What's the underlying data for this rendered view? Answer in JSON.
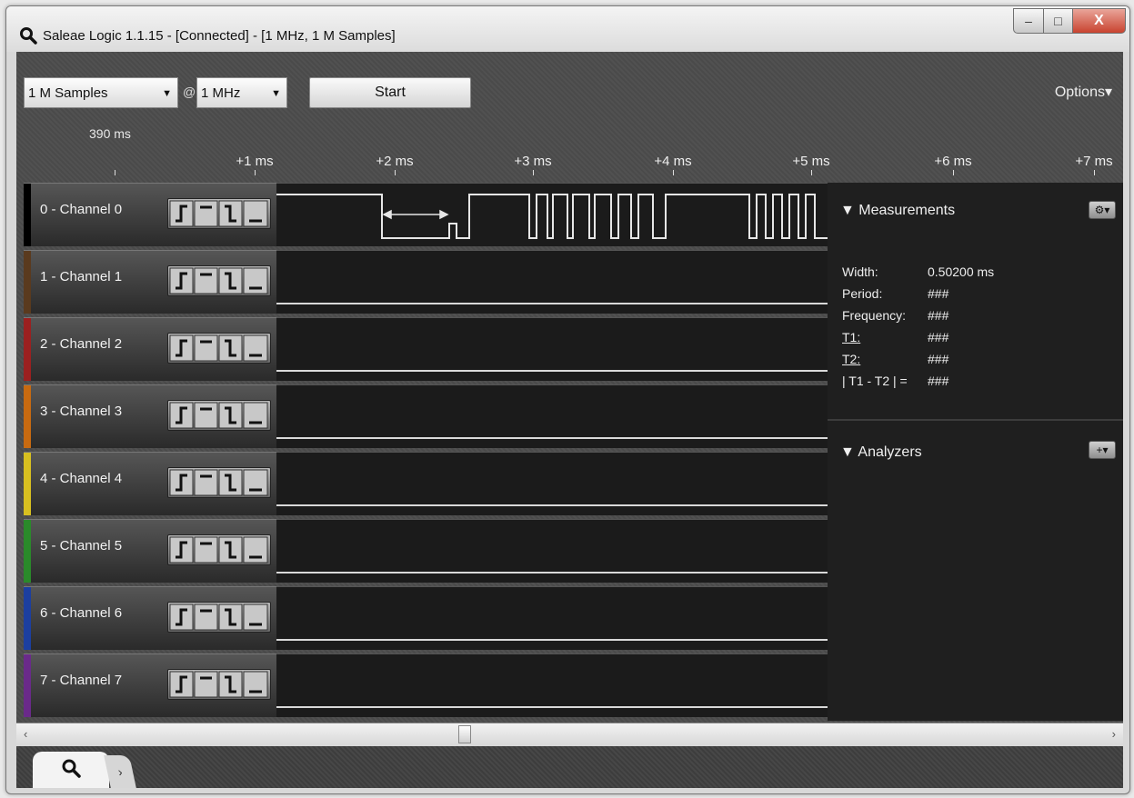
{
  "window": {
    "title": "Saleae Logic 1.1.15 - [Connected] - [1 MHz, 1 M Samples]",
    "controls": {
      "minimize": "–",
      "maximize": "□",
      "close": "X"
    }
  },
  "toolbar": {
    "samples_value": "1 M Samples",
    "at_symbol": "@",
    "rate_value": "1 MHz",
    "start_label": "Start",
    "options_label": "Options▾"
  },
  "timeline": {
    "origin": "390 ms",
    "ticks": [
      "+1 ms",
      "+2 ms",
      "+3 ms",
      "+4 ms",
      "+5 ms",
      "+6 ms",
      "+7 ms"
    ]
  },
  "channels": [
    {
      "label": "0 - Channel 0",
      "color": "#000000"
    },
    {
      "label": "1 - Channel 1",
      "color": "#5a3a1e"
    },
    {
      "label": "2 - Channel 2",
      "color": "#9b2020"
    },
    {
      "label": "3 - Channel 3",
      "color": "#c86a10"
    },
    {
      "label": "4 - Channel 4",
      "color": "#d8c020"
    },
    {
      "label": "5 - Channel 5",
      "color": "#2a8a2a"
    },
    {
      "label": "6 - Channel 6",
      "color": "#1c3fa0"
    },
    {
      "label": "7 - Channel 7",
      "color": "#6a2a8a"
    }
  ],
  "measurements": {
    "header": "▼ Measurements",
    "rows": [
      {
        "label": "Width:",
        "value": "0.50200 ms"
      },
      {
        "label": "Period:",
        "value": "###"
      },
      {
        "label": "Frequency:",
        "value": "###"
      },
      {
        "label": "T1:",
        "value": "###"
      },
      {
        "label": "T2:",
        "value": "###"
      },
      {
        "label": "| T1 - T2 | =",
        "value": "###"
      }
    ]
  },
  "analyzers": {
    "header": "▼ Analyzers",
    "add_label": "+▾"
  }
}
